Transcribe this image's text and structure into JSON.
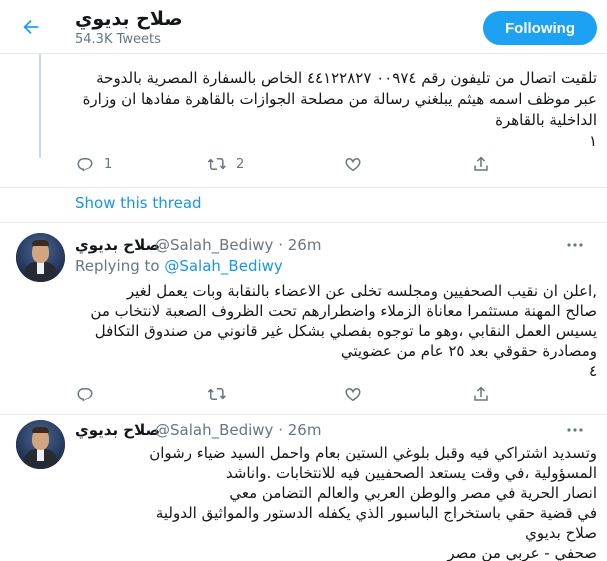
{
  "header": {
    "back_label": "Back",
    "title": "صلاح بديوي",
    "subtitle": "54.3K Tweets",
    "follow_label": "Following"
  },
  "tweet1": {
    "lines": [
      "تلقيت اتصال من تليفون رقم ٠٠٩٧٤ ٤٤١٢٢٨٢٧ الخاص بالسفارة المصرية بالدوحة",
      "عبر موظف اسمه هيثم يبلغني رسالة من مصلحة الجوازات بالقاهرة مفادها ان وزارة",
      "الداخلية بالقاهرة",
      "١"
    ],
    "reply_count": "1",
    "retweet_count": "2",
    "like_count": ""
  },
  "show_thread": "Show this thread",
  "tweet2": {
    "name": "صلاح بديوي",
    "handle_time": "@Salah_Bediwy · 26m",
    "replying_prefix": "Replying to ",
    "replying_to": "@Salah_Bediwy",
    "lines": [
      ",اعلن ان نقيب الصحفيين ومجلسه  تخلى عن الاعضاء بالنقابة  وبات يعمل لغير",
      "صالح المهنة مستثمرا معاناة الزملاء واضطرارهم تحت الظروف الصعبة لانتخاب من",
      "يسيس العمل النقابي ،وهو ما توجوه بفصلي بشكل غير قانوني من صندوق التكافل",
      "ومصادرة حقوقي بعد ٢٥ عام من عضويتي",
      "٤"
    ]
  },
  "tweet3": {
    "name": "صلاح بديوي",
    "handle_time": "@Salah_Bediwy · 26m",
    "lines": [
      "وتسديد اشتراكي فيه وقبل بلوغي الستين بعام واحمل السيد ضياء رشوان",
      "المسؤولية ،في وقت يستعد الصحفيين فيه للانتخابات     .واناشد",
      "انصار الحرية في مصر والوطن العربي والعالم التضامن معي",
      "في قضية حقي باستخراج الباسبور الذي يكفله الدستور والمواثيق الدولية",
      "صلاح بديوي",
      "صحفي - عربي من مصر"
    ]
  },
  "colors": {
    "accent": "#1da1f2",
    "link": "#1b95e0",
    "muted": "#657786",
    "divider": "#e6ecf0"
  },
  "icons": [
    "arrow-left-icon",
    "reply-icon",
    "retweet-icon",
    "like-icon",
    "share-icon",
    "more-icon"
  ]
}
